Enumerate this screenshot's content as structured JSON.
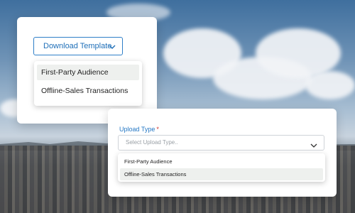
{
  "download_card": {
    "button_label": "Download Template",
    "button_icon": "chevron-down-icon",
    "options": [
      "First-Party Audience",
      "Offline-Sales Transactions"
    ]
  },
  "upload_card": {
    "field_label": "Upload Type",
    "required_marker": "*",
    "placeholder": "Select Upload Type..",
    "select_icon": "chevron-down-icon",
    "options": [
      "First-Party Audience",
      "Offline-Sales Transactions"
    ]
  },
  "colors": {
    "accent": "#2f7fc8",
    "required": "#d0342c",
    "highlight": "#eef0ee"
  }
}
